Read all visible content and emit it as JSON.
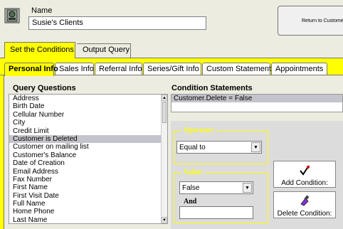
{
  "header": {
    "name_label": "Name",
    "name_value": "Susie's Clients",
    "return_button": "Return to Customer Q"
  },
  "main_tabs": [
    {
      "label": "Set the Conditions",
      "active": true
    },
    {
      "label": "Output Query",
      "active": false
    }
  ],
  "sub_tabs": [
    {
      "label": "Personal Info",
      "active": true
    },
    {
      "label": "Sales Info",
      "active": false
    },
    {
      "label": "Referral Info",
      "active": false
    },
    {
      "label": "Series/Gift Info",
      "active": false
    },
    {
      "label": "Custom Statement",
      "active": false
    },
    {
      "label": "Appointments",
      "active": false
    }
  ],
  "query_questions": {
    "title": "Query Questions",
    "selected": "Customer is Deleted",
    "items": [
      "Address",
      "Birth Date",
      "Cellular Number",
      "City",
      "Credit Limit",
      "Customer is Deleted",
      "Customer on mailing list",
      "Customer's Balance",
      "Date of Creation",
      "Email Address",
      "Fax Number",
      "First Name",
      "First Visit Date",
      "Full Name",
      "Home Phone",
      "Last Name"
    ]
  },
  "condition_statements": {
    "title": "Condition Statements",
    "rows": [
      "Customer.Delete = False"
    ]
  },
  "operator": {
    "legend": "Operator:",
    "value": "Equal to"
  },
  "value_group": {
    "legend": "Value:",
    "value": "False",
    "and_label": "And",
    "and_value": ""
  },
  "buttons": {
    "add": "Add Condition:",
    "delete": "Delete Condition:"
  },
  "colors": {
    "accent_yellow": "#ffff00",
    "selection_grey": "#c4c4cc",
    "panel_grey": "#dcdcdc"
  }
}
